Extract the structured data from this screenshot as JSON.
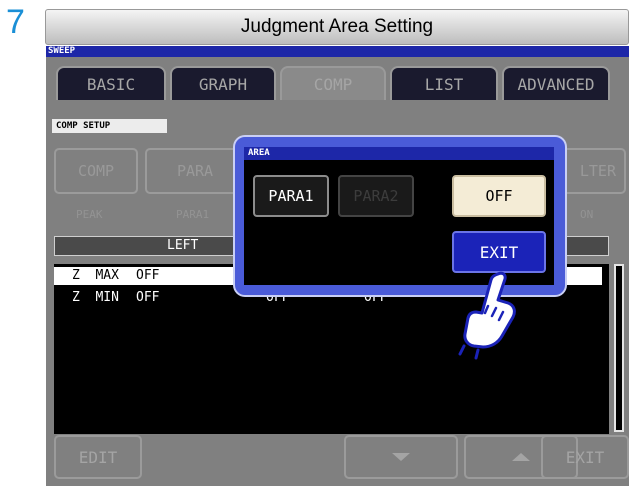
{
  "step_number": "7",
  "heading": "Judgment Area Setting",
  "mode_label": "SWEEP",
  "tabs": [
    {
      "label": "BASIC",
      "state": "inactive"
    },
    {
      "label": "GRAPH",
      "state": "inactive"
    },
    {
      "label": "COMP",
      "state": "active"
    },
    {
      "label": "LIST",
      "state": "inactive"
    },
    {
      "label": "ADVANCED",
      "state": "inactive"
    }
  ],
  "section_label": "COMP SETUP",
  "setup_buttons": {
    "comp": "COMP",
    "para": "PARA",
    "filter": "LTER"
  },
  "setup_values": {
    "peak": "PEAK",
    "para1": "PARA1",
    "on": "ON"
  },
  "table_header": {
    "left": "LEFT"
  },
  "rows": [
    {
      "name": "Z  MAX",
      "left": "OFF",
      "c2": "",
      "c3": "",
      "selected": true
    },
    {
      "name": "Z  MIN",
      "left": "OFF",
      "c2": "OFF",
      "c3": "OFF",
      "selected": false
    }
  ],
  "footer": {
    "edit": "EDIT",
    "exit": "EXIT"
  },
  "dialog": {
    "title": "AREA",
    "para1": "PARA1",
    "para2": "PARA2",
    "off": "OFF",
    "exit": "EXIT"
  },
  "colors": {
    "step_accent": "#1a8fd6",
    "mode_bar": "#1d27a8",
    "dialog_border": "#4a5bd8",
    "selected_option": "#f4ecd6",
    "exit_button": "#1b23b8"
  },
  "icons": {
    "pointer": "pointing-hand-icon",
    "scroll_down": "triangle-down-icon",
    "scroll_up": "triangle-up-icon"
  }
}
